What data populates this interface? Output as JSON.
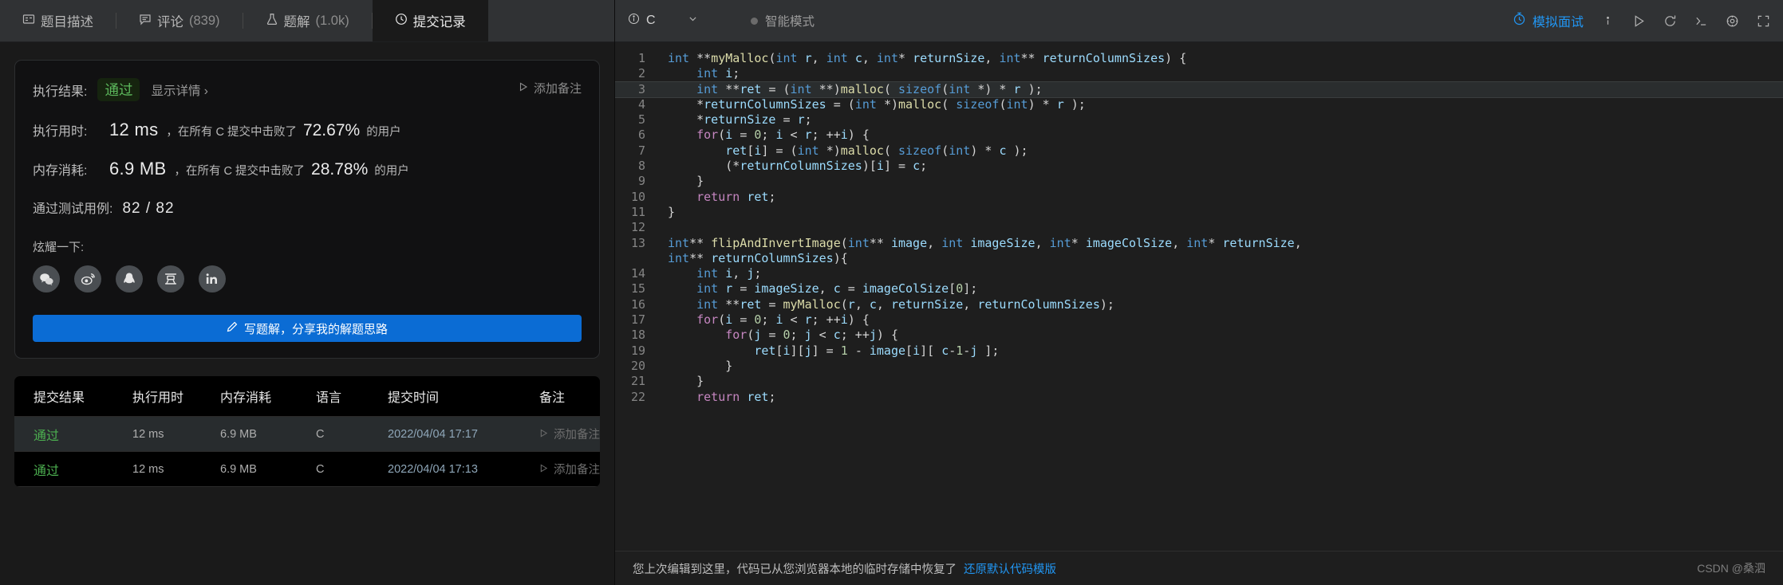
{
  "left": {
    "tabs": [
      {
        "label": "题目描述",
        "icon": "description-icon",
        "count": "",
        "active": false
      },
      {
        "label": "评论",
        "icon": "comment-icon",
        "count": "(839)",
        "active": false
      },
      {
        "label": "题解",
        "icon": "flask-icon",
        "count": "(1.0k)",
        "active": false
      },
      {
        "label": "提交记录",
        "icon": "clock-icon",
        "count": "",
        "active": true
      }
    ],
    "result": {
      "result_label": "执行结果:",
      "status": "通过",
      "detail_link": "显示详情 ›",
      "add_note": "添加备注",
      "runtime_label": "执行用时:",
      "runtime_value": "12 ms",
      "runtime_tail_pre": "，在所有 C 提交中击败了",
      "runtime_pct": "72.67%",
      "runtime_tail_post": "的用户",
      "memory_label": "内存消耗:",
      "memory_value": "6.9 MB",
      "memory_tail_pre": "，在所有 C 提交中击败了",
      "memory_pct": "28.78%",
      "memory_tail_post": "的用户",
      "cases_label": "通过测试用例:",
      "cases_value": "82 / 82",
      "share_title": "炫耀一下:",
      "share_icons": [
        "wechat-icon",
        "weibo-icon",
        "qq-icon",
        "douban-icon",
        "linkedin-icon"
      ],
      "write_button": "写题解，分享我的解题思路"
    },
    "table": {
      "headers": [
        "提交结果",
        "执行用时",
        "内存消耗",
        "语言",
        "提交时间",
        "备注"
      ],
      "rows": [
        {
          "status": "通过",
          "runtime": "12 ms",
          "memory": "6.9 MB",
          "lang": "C",
          "time": "2022/04/04 17:17",
          "note": "添加备注"
        },
        {
          "status": "通过",
          "runtime": "12 ms",
          "memory": "6.9 MB",
          "lang": "C",
          "time": "2022/04/04 17:13",
          "note": "添加备注"
        }
      ]
    }
  },
  "editor": {
    "language": "C",
    "smart_mode": "智能模式",
    "mock_interview": "模拟面试",
    "header_icons": [
      "info-icon",
      "run-icon",
      "reset-icon",
      "console-icon",
      "settings-icon",
      "fullscreen-icon"
    ],
    "status_text": "您上次编辑到这里，代码已从您浏览器本地的临时存储中恢复了",
    "restore_link": "还原默认代码模版",
    "watermark": "CSDN @桑泗",
    "line_numbers": [
      "1",
      "2",
      "3",
      "4",
      "5",
      "6",
      "7",
      "8",
      "9",
      "10",
      "11",
      "12",
      "13",
      "",
      "14",
      "15",
      "16",
      "17",
      "18",
      "19",
      "20",
      "21",
      "22"
    ],
    "highlight_line": 3,
    "code_lines": [
      "int **myMalloc(int r, int c, int* returnSize, int** returnColumnSizes) {",
      "    int i;",
      "    int **ret = (int **)malloc( sizeof(int *) * r );",
      "    *returnColumnSizes = (int *)malloc( sizeof(int) * r );",
      "    *returnSize = r;",
      "    for(i = 0; i < r; ++i) {",
      "        ret[i] = (int *)malloc( sizeof(int) * c );",
      "        (*returnColumnSizes)[i] = c;",
      "    }",
      "    return ret;",
      "}",
      "",
      "int** flipAndInvertImage(int** image, int imageSize, int* imageColSize, int* returnSize,",
      "int** returnColumnSizes){",
      "    int i, j;",
      "    int r = imageSize, c = imageColSize[0];",
      "    int **ret = myMalloc(r, c, returnSize, returnColumnSizes);",
      "    for(i = 0; i < r; ++i) {",
      "        for(j = 0; j < c; ++j) {",
      "            ret[i][j] = 1 - image[i][ c-1-j ];",
      "        }",
      "    }",
      "    return ret;"
    ]
  },
  "colors": {
    "accent_blue": "#0b6cd4",
    "pass_green": "#5cb85c",
    "link_blue": "#2196f3",
    "editor_bg": "#1e1e1e",
    "panel_bg": "#1a1a1a"
  }
}
